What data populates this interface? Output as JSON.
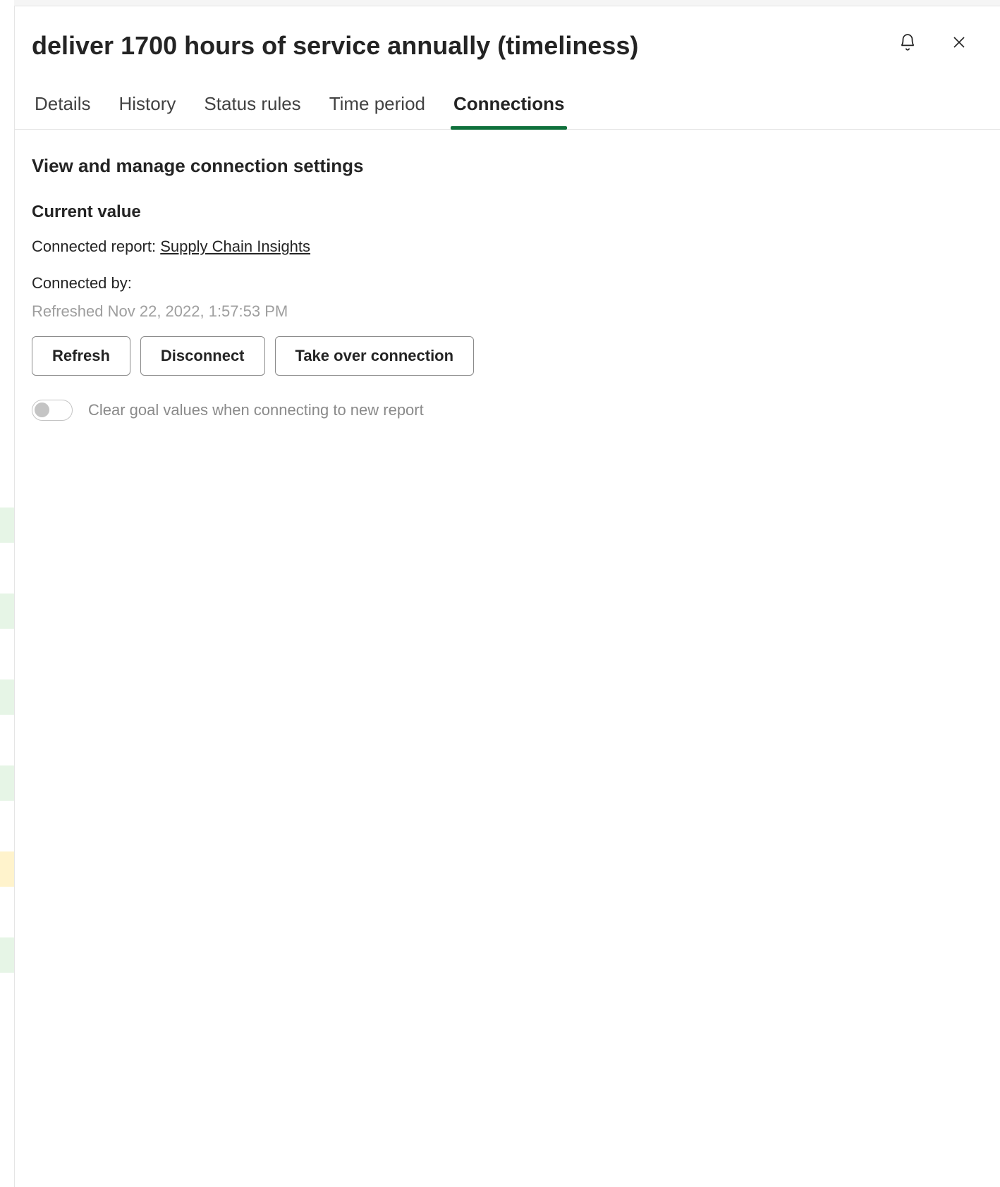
{
  "header": {
    "title": "deliver 1700 hours of service annually (timeliness)"
  },
  "tabs": {
    "details": "Details",
    "history": "History",
    "status_rules": "Status rules",
    "time_period": "Time period",
    "connections": "Connections"
  },
  "section": {
    "title": "View and manage connection settings",
    "current_value_heading": "Current value",
    "connected_report_label": "Connected report: ",
    "connected_report_name": "Supply Chain Insights",
    "connected_by_label": "Connected by:",
    "refreshed_text": "Refreshed Nov 22, 2022, 1:57:53 PM"
  },
  "buttons": {
    "refresh": "Refresh",
    "disconnect": "Disconnect",
    "take_over": "Take over connection"
  },
  "toggle": {
    "clear_goal_label": "Clear goal values when connecting to new report"
  }
}
